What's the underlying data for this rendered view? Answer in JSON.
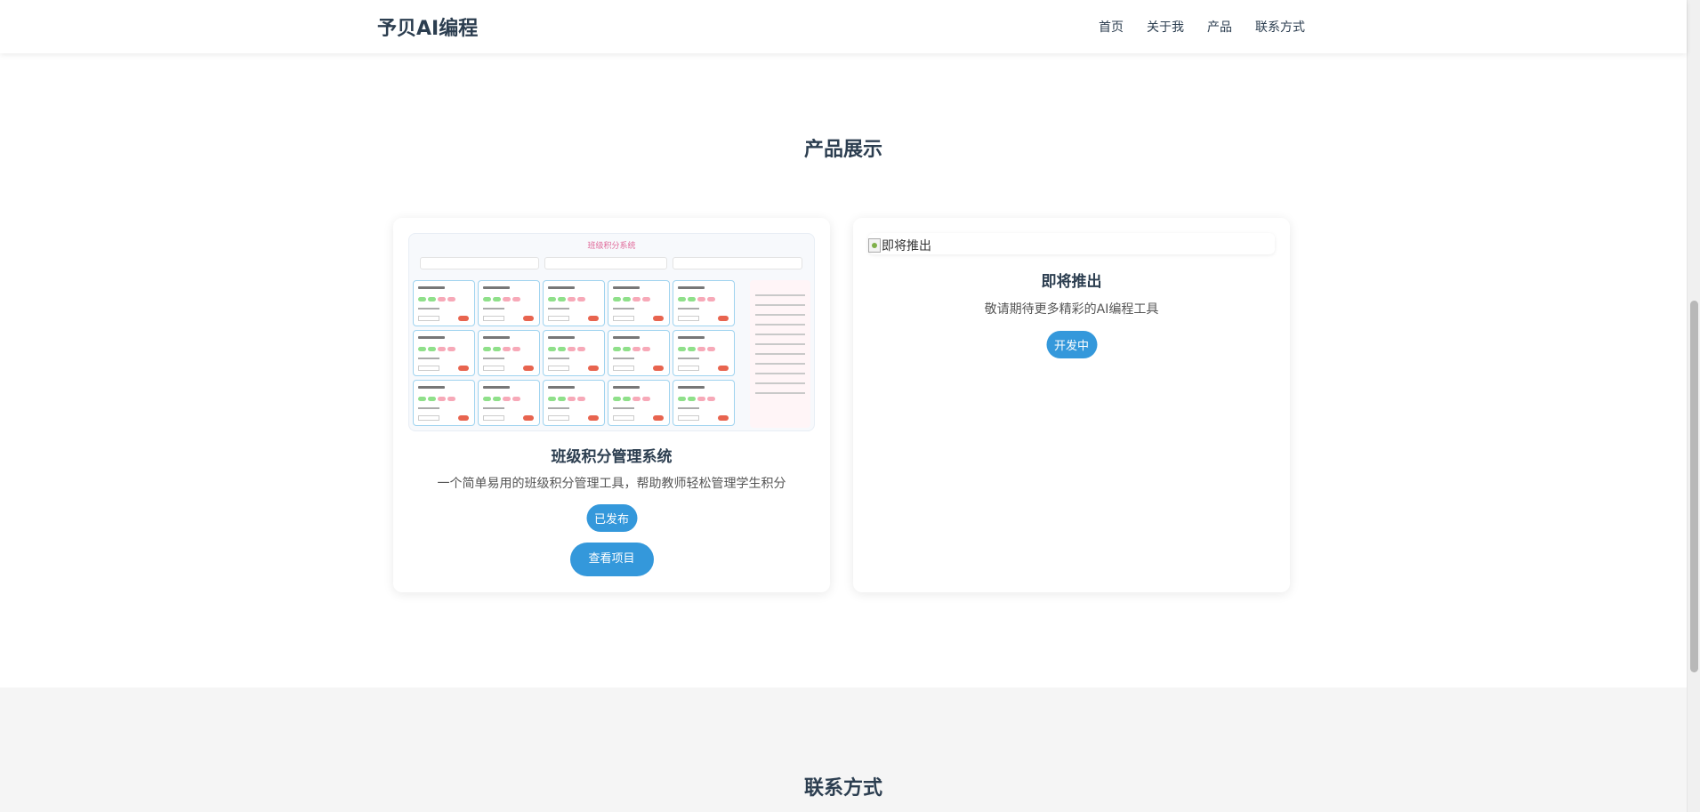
{
  "header": {
    "logo": "予贝AI编程",
    "nav": [
      "首页",
      "关于我",
      "产品",
      "联系方式"
    ]
  },
  "products": {
    "title": "产品展示",
    "cards": [
      {
        "mini_title": "班级积分系统",
        "title": "班级积分管理系统",
        "description": "一个简单易用的班级积分管理工具，帮助教师轻松管理学生积分",
        "status": "已发布",
        "button": "查看项目"
      },
      {
        "image_alt": "即将推出",
        "title": "即将推出",
        "description": "敬请期待更多精彩的AI编程工具",
        "status": "开发中"
      }
    ]
  },
  "contact": {
    "title": "联系方式"
  },
  "colors": {
    "accent": "#3498db",
    "text": "#2c3e50",
    "section_alt_bg": "#f5f5f5"
  }
}
